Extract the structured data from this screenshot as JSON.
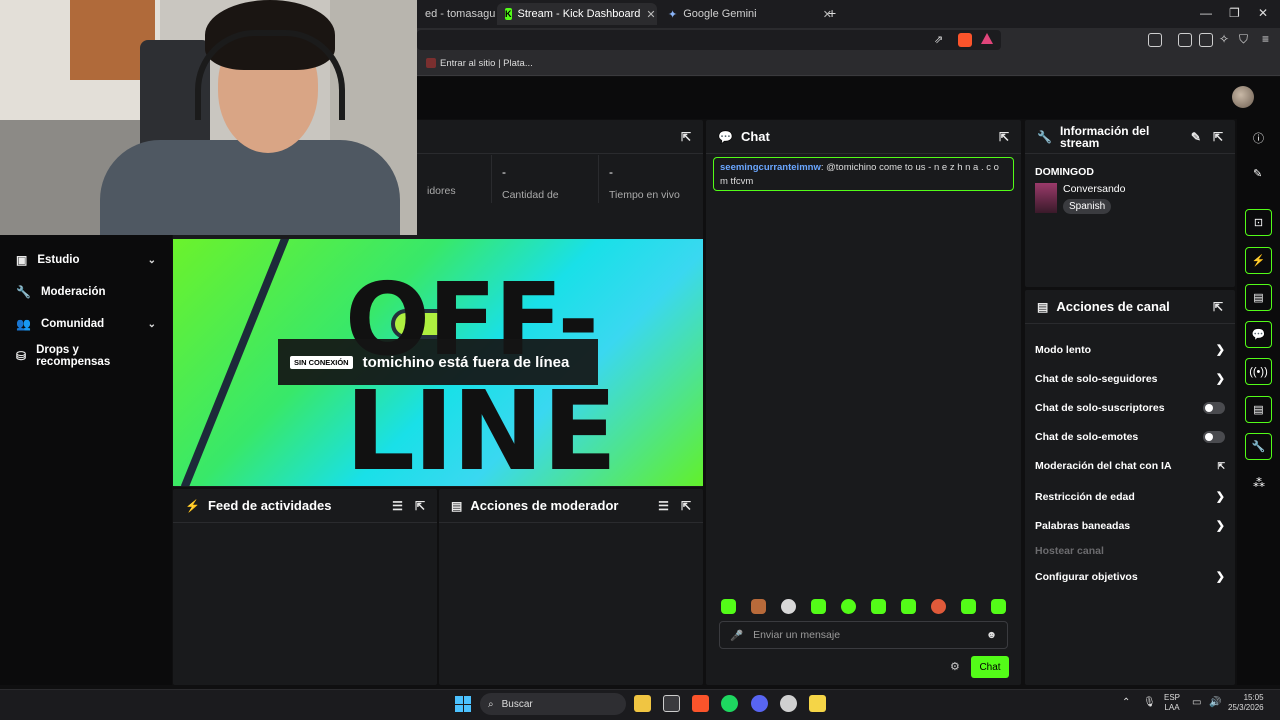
{
  "browser": {
    "tabs": [
      {
        "label": "ed - tomasagustinn"
      },
      {
        "label": "Stream - Kick Dashboard"
      },
      {
        "label": "Google Gemini"
      }
    ],
    "new_tab": "+",
    "bookmark": "Entrar al sitio | Plata..."
  },
  "sidebar": {
    "items": [
      {
        "label": "Estudio",
        "icon": "studio-icon"
      },
      {
        "label": "Moderación",
        "icon": "wrench-icon"
      },
      {
        "label": "Comunidad",
        "icon": "community-icon"
      },
      {
        "label": "Drops y recompensas",
        "icon": "drops-icon"
      }
    ]
  },
  "stats": [
    {
      "value": "",
      "label": "idores"
    },
    {
      "value": "-",
      "label": "Cantidad de"
    },
    {
      "value": "-",
      "label": "Tiempo en vivo"
    }
  ],
  "video": {
    "badge": "SIN CONEXIÓN",
    "message": "tomichino está fuera de línea",
    "bg_text_top": "OFF-",
    "bg_text_bottom": "LINE"
  },
  "feed": {
    "title": "Feed de actividades"
  },
  "modactions": {
    "title": "Acciones de moderador"
  },
  "chat": {
    "title": "Chat",
    "messages": [
      {
        "user": "seemingcurranteimnw",
        "text": ": @tomichino come to us - n e z h n a . c o m tfcvm"
      }
    ],
    "placeholder": "Enviar un mensaje",
    "send_label": "Chat"
  },
  "streaminfo": {
    "title_line1": "Información del",
    "title_line2": "stream",
    "stream_title": "DOMINGOD",
    "category": "Conversando",
    "language": "Spanish"
  },
  "channel_actions": {
    "title": "Acciones de canal",
    "items": [
      {
        "label": "Modo lento",
        "control": "chevron"
      },
      {
        "label": "Chat de solo-seguidores",
        "control": "chevron"
      },
      {
        "label": "Chat de solo-suscriptores",
        "control": "toggle",
        "on": false
      },
      {
        "label": "Chat de solo-emotes",
        "control": "toggle",
        "on": false
      },
      {
        "label": "Moderación del chat con IA",
        "control": "external"
      },
      {
        "label": "Restricción de edad",
        "control": "chevron"
      },
      {
        "label": "Palabras baneadas",
        "control": "chevron"
      },
      {
        "label": "Hostear canal",
        "control": "disabled"
      },
      {
        "label": "Configurar objetivos",
        "control": "chevron"
      }
    ]
  },
  "taskbar": {
    "search": "Buscar",
    "lang_top": "ESP",
    "lang_bottom": "LAA",
    "time": "15:05",
    "date": "25/3/2026"
  },
  "colors": {
    "accent": "#53fc18",
    "panel": "#191a1c",
    "background": "#0f0f10"
  }
}
